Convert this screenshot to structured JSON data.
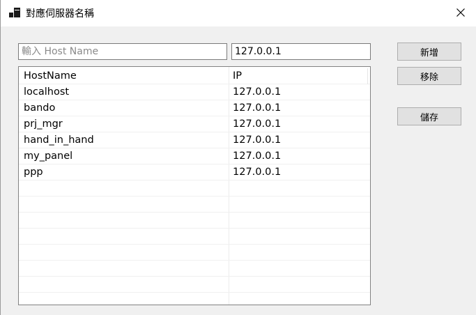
{
  "window": {
    "title": "對應伺服器名稱"
  },
  "inputs": {
    "hostname_placeholder": "輸入 Host Name",
    "hostname_value": "",
    "ip_value": "127.0.0.1"
  },
  "buttons": {
    "add": "新增",
    "remove": "移除",
    "save": "儲存"
  },
  "table": {
    "columns": [
      "HostName",
      "IP"
    ],
    "rows": [
      {
        "host": "localhost",
        "ip": "127.0.0.1"
      },
      {
        "host": "bando",
        "ip": "127.0.0.1"
      },
      {
        "host": "prj_mgr",
        "ip": "127.0.0.1"
      },
      {
        "host": "hand_in_hand",
        "ip": "127.0.0.1"
      },
      {
        "host": "my_panel",
        "ip": "127.0.0.1"
      },
      {
        "host": "ppp",
        "ip": "127.0.0.1"
      }
    ]
  },
  "icons": {
    "app": "window-app-icon",
    "close": "close-icon"
  }
}
